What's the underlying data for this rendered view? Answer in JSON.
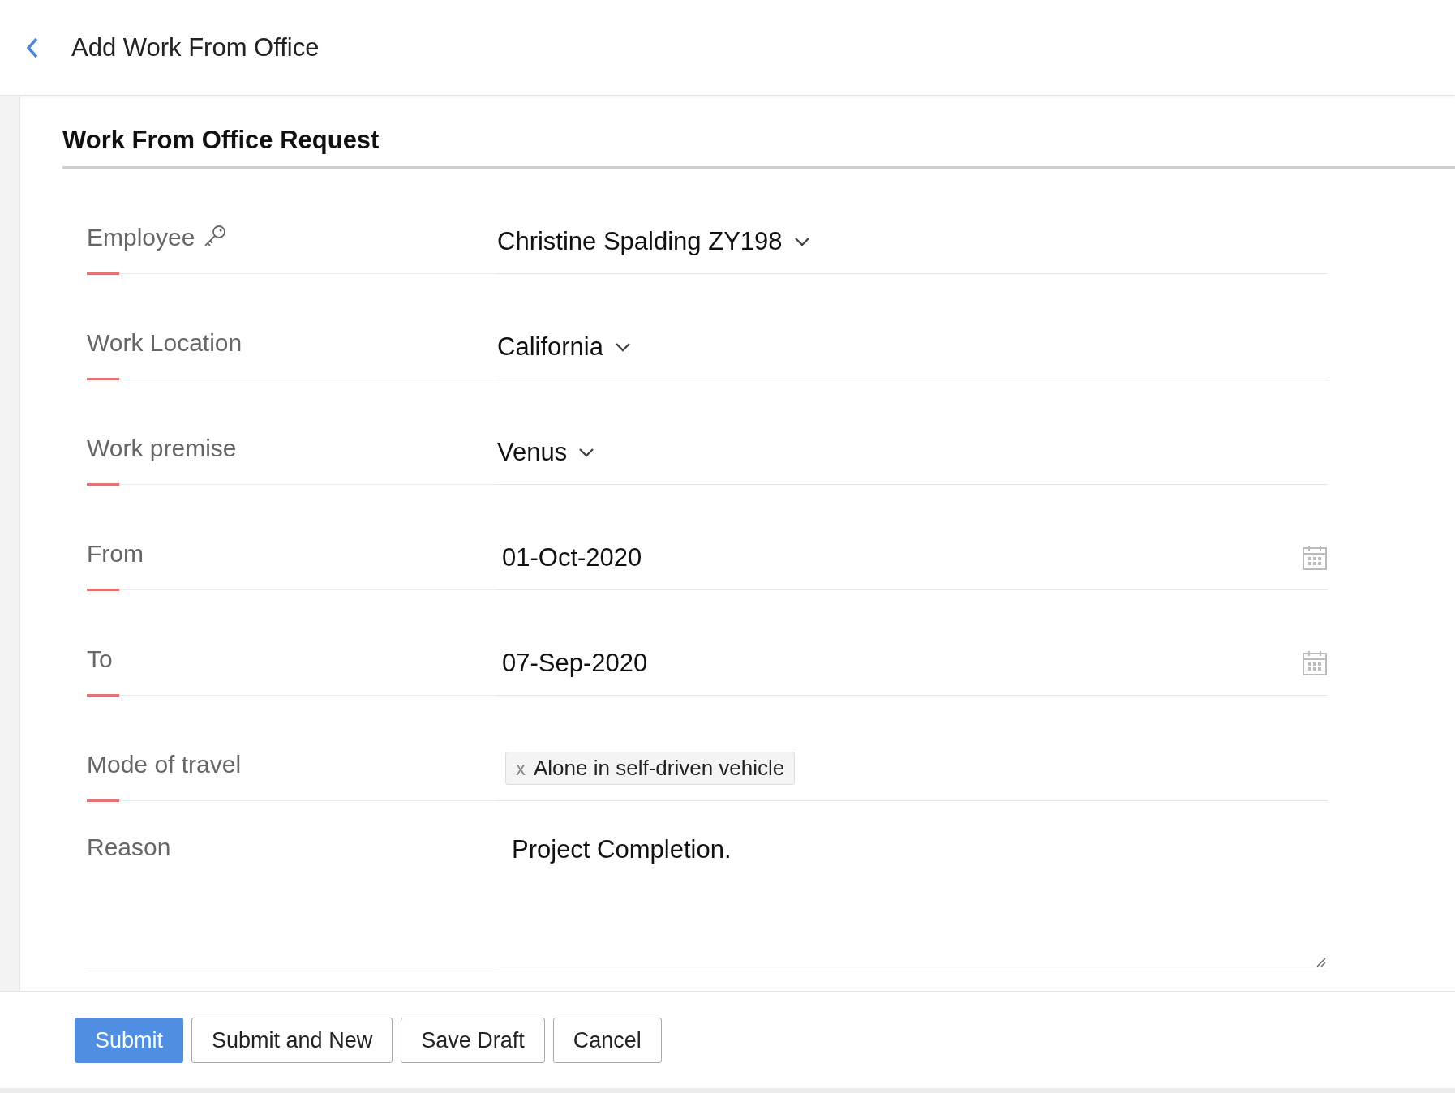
{
  "header": {
    "title": "Add Work From Office"
  },
  "section": {
    "title": "Work From Office Request"
  },
  "fields": [
    {
      "label": "Employee",
      "kind": "dropdown",
      "value": "Christine Spalding ZY198",
      "required": true,
      "key_icon": true
    },
    {
      "label": "Work Location",
      "kind": "dropdown",
      "value": "California",
      "required": true
    },
    {
      "label": "Work premise",
      "kind": "dropdown",
      "value": "Venus",
      "required": true
    },
    {
      "label": "From",
      "kind": "date",
      "value": "01-Oct-2020",
      "required": true
    },
    {
      "label": "To",
      "kind": "date",
      "value": "07-Sep-2020",
      "required": true
    },
    {
      "label": "Mode of travel",
      "kind": "tags",
      "tags": [
        {
          "remove": "x",
          "text": "Alone in self-driven vehicle"
        }
      ],
      "required": true
    },
    {
      "label": "Reason",
      "kind": "textarea",
      "value": "Project Completion.",
      "required": false
    }
  ],
  "buttons": [
    {
      "label": "Submit",
      "primary": true
    },
    {
      "label": "Submit and New",
      "primary": false
    },
    {
      "label": "Save Draft",
      "primary": false
    },
    {
      "label": "Cancel",
      "primary": false
    }
  ]
}
